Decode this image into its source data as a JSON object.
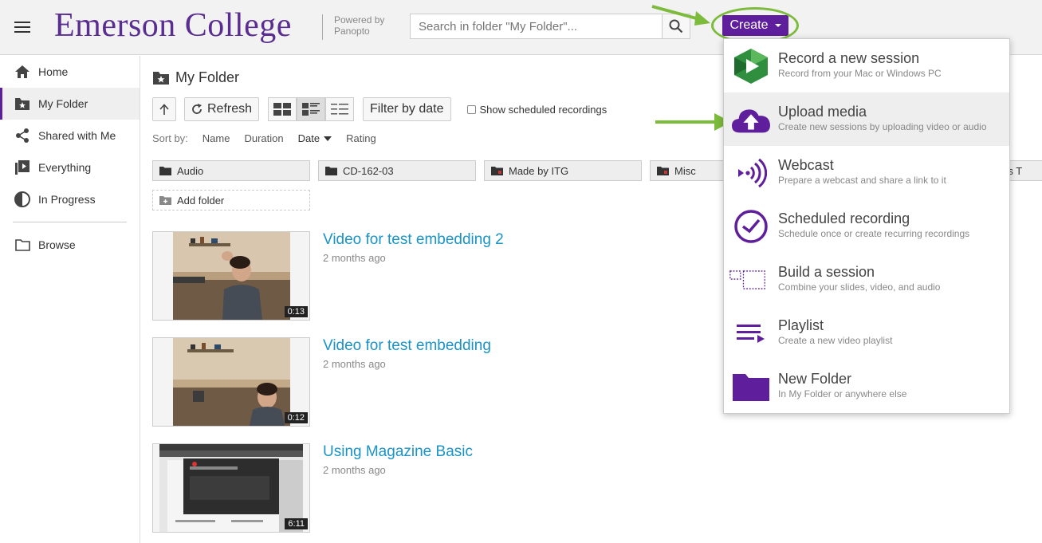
{
  "header": {
    "logo_text": "Emerson College",
    "powered_line1": "Powered by",
    "powered_line2": "Panopto",
    "search_placeholder": "Search in folder \"My Folder\"...",
    "create_label": "Create"
  },
  "sidebar": {
    "items": [
      {
        "label": "Home",
        "icon": "home-icon"
      },
      {
        "label": "My Folder",
        "icon": "star-folder-icon",
        "active": true
      },
      {
        "label": "Shared with Me",
        "icon": "share-icon"
      },
      {
        "label": "Everything",
        "icon": "play-stack-icon"
      },
      {
        "label": "In Progress",
        "icon": "progress-circle-icon"
      }
    ],
    "browse": {
      "label": "Browse",
      "icon": "folder-outline-icon"
    }
  },
  "main": {
    "folder_title": "My Folder",
    "toolbar": {
      "refresh": "Refresh",
      "filter": "Filter by date",
      "show_scheduled": "Show scheduled recordings"
    },
    "sort": {
      "label": "Sort by:",
      "options": [
        "Name",
        "Duration",
        "Date",
        "Rating"
      ],
      "selected": "Date"
    },
    "folders": [
      "Audio",
      "CD-162-03",
      "Made by ITG",
      "Misc",
      "Stress T"
    ],
    "add_folder": "Add folder",
    "sessions": [
      {
        "title": "Video for test embedding 2",
        "date": "2 months ago",
        "duration": "0:13"
      },
      {
        "title": "Video for test embedding",
        "date": "2 months ago",
        "duration": "0:12"
      },
      {
        "title": "Using Magazine Basic",
        "date": "2 months ago",
        "duration": "6:11"
      }
    ]
  },
  "menu": {
    "items": [
      {
        "title": "Record a new session",
        "sub": "Record from your Mac or Windows PC",
        "icon": "panopto-record-icon"
      },
      {
        "title": "Upload media",
        "sub": "Create new sessions by uploading video or audio",
        "icon": "cloud-upload-icon",
        "highlighted": true
      },
      {
        "title": "Webcast",
        "sub": "Prepare a webcast and share a link to it",
        "icon": "webcast-icon"
      },
      {
        "title": "Scheduled recording",
        "sub": "Schedule once or create recurring recordings",
        "icon": "clock-icon"
      },
      {
        "title": "Build a session",
        "sub": "Combine your slides, video, and audio",
        "icon": "build-session-icon"
      },
      {
        "title": "Playlist",
        "sub": "Create a new video playlist",
        "icon": "playlist-icon"
      },
      {
        "title": "New Folder",
        "sub": "In My Folder or anywhere else",
        "icon": "folder-icon"
      }
    ]
  },
  "colors": {
    "brand_purple": "#5f1e9b",
    "link_blue": "#1a93c6",
    "annotation_green": "#7dbb3c"
  }
}
